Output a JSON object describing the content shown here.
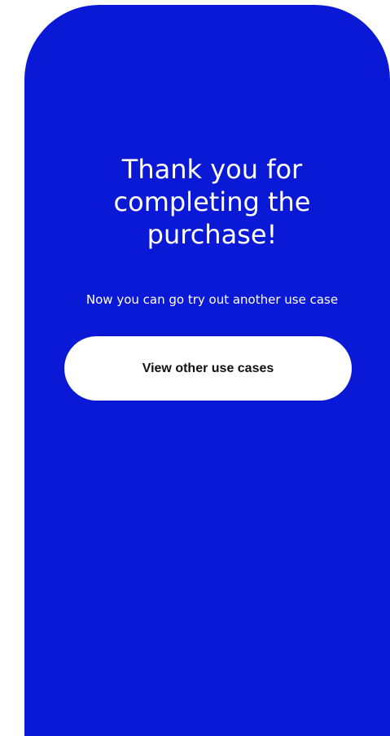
{
  "thank_you": {
    "title_line1": "Thank you for",
    "title_line2": "completing the",
    "title_line3": "purchase!",
    "subtitle": "Now you can go try out another use case",
    "cta_label": "View other use cases"
  },
  "colors": {
    "card_background": "#0a19d6",
    "page_background": "#ffffff",
    "cta_background": "#ffffff",
    "text_on_card": "#ffffff",
    "cta_text": "#111111"
  }
}
